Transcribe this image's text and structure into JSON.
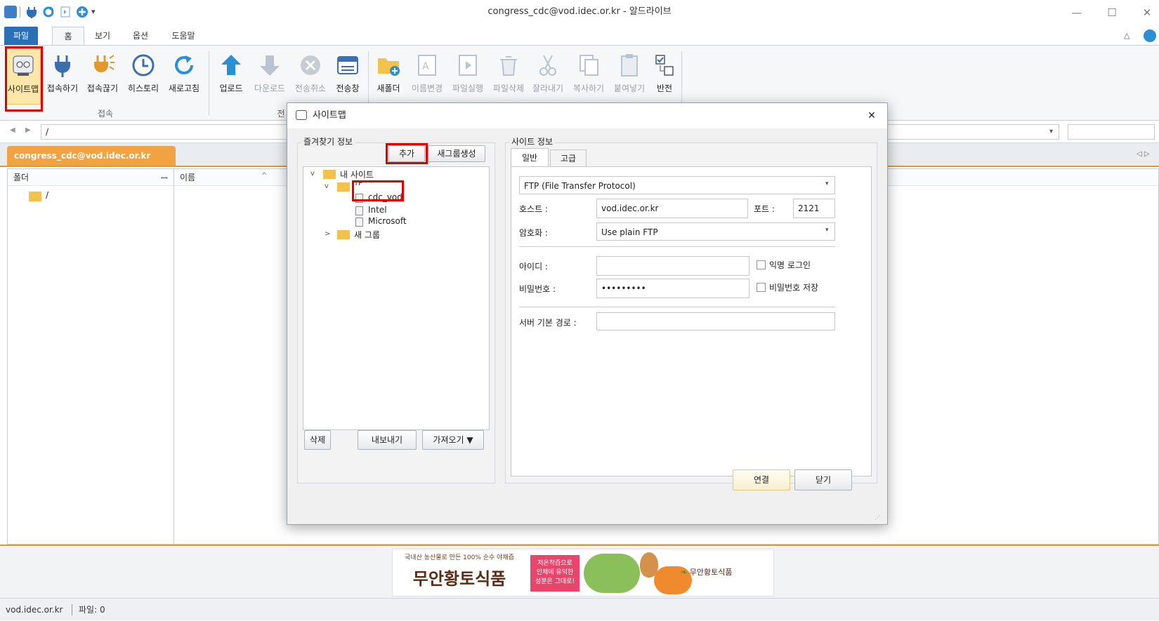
{
  "window": {
    "title": "congress_cdc@vod.idec.or.kr - 알드라이브",
    "controls": {
      "minimize": "—",
      "maximize": "☐",
      "close": "✕",
      "collapse": "△"
    }
  },
  "ribbon": {
    "tabs": [
      {
        "label": "파일"
      },
      {
        "label": "홈"
      },
      {
        "label": "보기"
      },
      {
        "label": "옵션"
      },
      {
        "label": "도움말"
      }
    ],
    "connect_group": {
      "label": "접속",
      "buttons": [
        {
          "label": "사이트맵"
        },
        {
          "label": "접속하기"
        },
        {
          "label": "접속끊기"
        },
        {
          "label": "히스토리"
        },
        {
          "label": "새로고침"
        }
      ]
    },
    "transfer_group": {
      "label": "전",
      "buttons": [
        {
          "label": "업로드"
        },
        {
          "label": "다운로드"
        },
        {
          "label": "전송취소"
        },
        {
          "label": "전송창"
        }
      ]
    },
    "file_group": {
      "buttons": [
        {
          "label": "새폴더"
        },
        {
          "label": "이름변경"
        },
        {
          "label": "파일실행"
        },
        {
          "label": "파일삭제"
        },
        {
          "label": "잘라내기"
        },
        {
          "label": "복사하기"
        },
        {
          "label": "붙여넣기"
        },
        {
          "label": "반전"
        }
      ]
    }
  },
  "address": {
    "path": "/"
  },
  "session_tab": {
    "label": "congress_cdc@vod.idec.or.kr"
  },
  "folder_panel": {
    "header": "폴더",
    "pin": "ꟷ",
    "root": "/"
  },
  "file_panel": {
    "header_name": "이름"
  },
  "dialog": {
    "title": "사이트맵",
    "close": "✕",
    "favorites": {
      "legend": "즐겨찾기 정보",
      "add_button": "추가",
      "new_group_button": "새그룹생성",
      "tree": {
        "root": "내 사이트",
        "group": "TP",
        "items": [
          "cdc_vod",
          "Intel",
          "Microsoft"
        ],
        "new_group": "새 그룹"
      },
      "delete_button": "삭제",
      "export_button": "내보내기",
      "import_button": "가져오기 ▼"
    },
    "site_info": {
      "legend": "사이트 정보",
      "tabs": [
        "일반",
        "고급"
      ],
      "protocol": "FTP (File Transfer Protocol)",
      "host_label": "호스트 :",
      "host_value": "vod.idec.or.kr",
      "port_label": "포트 :",
      "port_value": "2121",
      "encryption_label": "암호화 :",
      "encryption_value": "Use plain FTP",
      "id_label": "아이디 :",
      "anonymous_label": "익명 로그인",
      "password_label": "비밀번호 :",
      "password_value": "•••••••••",
      "save_password_label": "비밀번호 저장",
      "server_path_label": "서버 기본 경로 :"
    },
    "connect_button": "연결",
    "close_button": "닫기"
  },
  "ad": {
    "tagline": "국내산 농산물로 만든 100% 순수 야채즙",
    "brand": "무안황토식품",
    "badge_lines": [
      "저온착즙으로",
      "인체에 유익한",
      "성분은 그대로!"
    ],
    "logo_text": "무안황토식품"
  },
  "status": {
    "host": "vod.idec.or.kr",
    "files": "파일: 0"
  }
}
